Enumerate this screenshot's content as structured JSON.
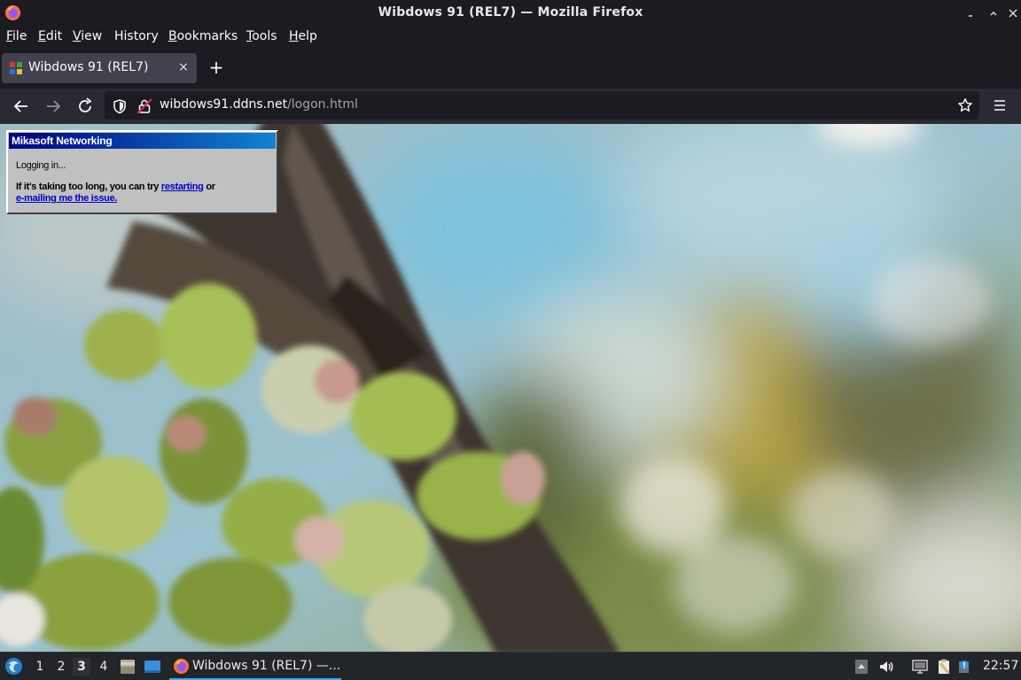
{
  "window": {
    "title": "Wibdows 91 (REL7) — Mozilla Firefox",
    "controls": {
      "minimize": "_",
      "maximize": "▫",
      "close": "✕"
    }
  },
  "menu": [
    {
      "label": "File",
      "accel": "F",
      "rest": "ile"
    },
    {
      "label": "Edit",
      "accel": "E",
      "rest": "dit"
    },
    {
      "label": "View",
      "accel": "V",
      "rest": "iew"
    },
    {
      "label": "History",
      "accel": "",
      "rest": "History"
    },
    {
      "label": "Bookmarks",
      "accel": "B",
      "rest": "ookmarks"
    },
    {
      "label": "Tools",
      "accel": "T",
      "rest": "ools"
    },
    {
      "label": "Help",
      "accel": "H",
      "rest": "elp"
    }
  ],
  "tab": {
    "title": "Wibdows 91 (REL7)",
    "close": "×"
  },
  "newtab_label": "+",
  "url": {
    "host": "wibdows91.ddns.net",
    "path": "/logon.html"
  },
  "icons": {
    "back": "arrow-left-icon",
    "forward": "arrow-right-icon",
    "reload": "reload-icon",
    "shield": "shield-icon",
    "lock": "lock-icon",
    "star": "star-icon",
    "menu": "hamburger-icon"
  },
  "dialog": {
    "title": "Mikasoft Networking",
    "status": "Logging in...",
    "message_prefix": "If it's taking too long, you can try ",
    "link_restart": "restarting",
    "message_mid": " or",
    "link_email": "e-mailing me the issue."
  },
  "taskbar": {
    "workspaces": [
      "1",
      "2",
      "3",
      "4"
    ],
    "active_workspace": "3",
    "task_label": "Wibdows 91 (REL7) —...",
    "clock": "22:57"
  },
  "colors": {
    "chrome_dark": "#1c1b22",
    "toolbar": "#2b2a33",
    "tab_active": "#42414d",
    "dialog_face": "#c0c0c0",
    "dialog_title": "#000080",
    "taskbar": "#22252a",
    "accent": "#3daee9"
  }
}
